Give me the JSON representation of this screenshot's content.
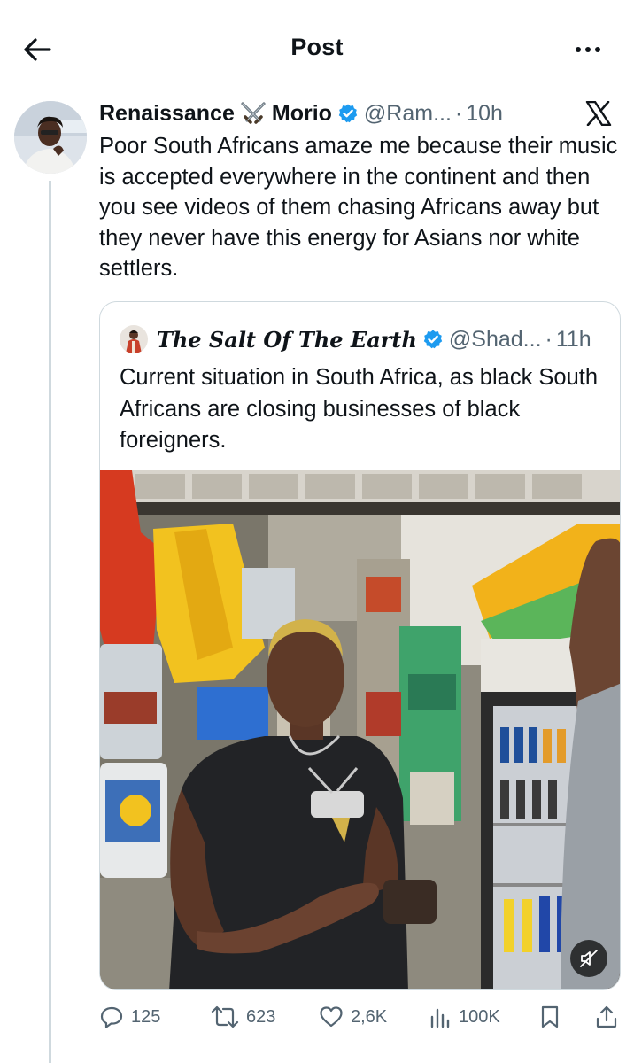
{
  "header": {
    "title": "Post",
    "back_icon": "arrow-left-icon",
    "more_icon": "more-horizontal-icon"
  },
  "tweet": {
    "author_name": "Renaissance",
    "author_emoji": "crossed-swords-icon",
    "author_name_2": "Morio",
    "handle": "@Ram...",
    "separator": "·",
    "time": "10h",
    "text": "Poor South Africans amaze me because their music is accepted everywhere in the continent and then you see videos of them chasing Africans away but they never have this energy for Asians nor white settlers."
  },
  "quote": {
    "author_name": "The Salt Of The Earth",
    "handle": "@Shad...",
    "separator": "·",
    "time": "11h",
    "text": "Current situation in South Africa, as black South Africans are closing businesses of black foreigners."
  },
  "actions": {
    "replies": "125",
    "reposts": "623",
    "likes": "2,6K",
    "views": "100K"
  },
  "colors": {
    "verified": "#1d9bf0",
    "secondary_text": "#536471",
    "border": "#cfd9de"
  }
}
